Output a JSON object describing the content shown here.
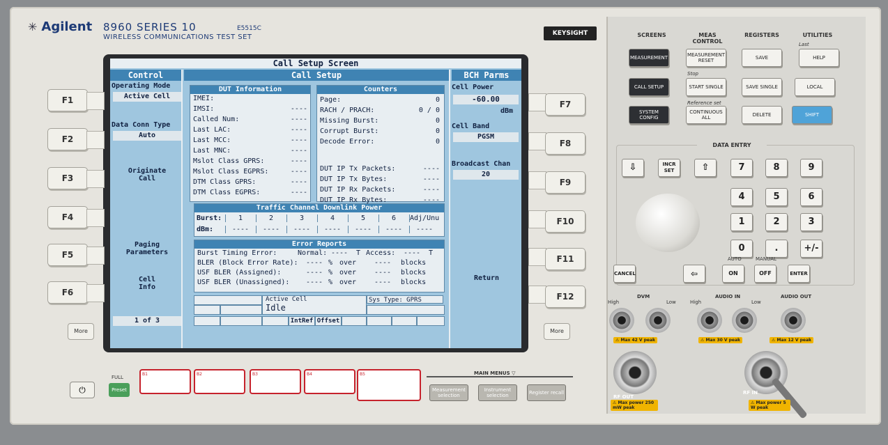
{
  "brand": {
    "logo": "Agilent",
    "series": "8960 SERIES 10",
    "subtitle": "WIRELESS COMMUNICATIONS TEST SET",
    "partno": "E5515C",
    "keysight": "KEYSIGHT"
  },
  "screen": {
    "title": "Call Setup Screen",
    "control_header": "Control",
    "call_setup_header": "Call Setup",
    "bch_header": "BCH Parms",
    "left_soft": {
      "operating_mode_label": "Operating Mode",
      "operating_mode_value": "Active Cell",
      "data_conn_label": "Data Conn Type",
      "data_conn_value": "Auto",
      "originate": "Originate\nCall",
      "paging": "Paging\nParameters",
      "cell_info": "Cell\nInfo",
      "page_indicator": "1 of 3"
    },
    "dut": {
      "header": "DUT Information",
      "rows": [
        {
          "label": "IMEI:",
          "value": ""
        },
        {
          "label": "IMSI:",
          "value": "----"
        },
        {
          "label": "Called Num:",
          "value": "----"
        },
        {
          "label": "Last LAC:",
          "value": "----"
        },
        {
          "label": "Last MCC:",
          "value": "----"
        },
        {
          "label": "Last MNC:",
          "value": "----"
        },
        {
          "label": "Mslot Class GPRS:",
          "value": "----"
        },
        {
          "label": "Mslot Class EGPRS:",
          "value": "----"
        },
        {
          "label": "DTM Class GPRS:",
          "value": "----"
        },
        {
          "label": "DTM Class EGPRS:",
          "value": "----"
        }
      ]
    },
    "counters": {
      "header": "Counters",
      "rows": [
        {
          "label": "Page:",
          "value": "0"
        },
        {
          "label": "RACH / PRACH:",
          "value": "0 / 0"
        },
        {
          "label": "Missing Burst:",
          "value": "0"
        },
        {
          "label": "Corrupt Burst:",
          "value": "0"
        },
        {
          "label": "Decode Error:",
          "value": "0"
        },
        {
          "label": "DUT IP Tx Packets:",
          "value": "----"
        },
        {
          "label": "DUT IP Tx Bytes:",
          "value": "----"
        },
        {
          "label": "DUT IP Rx Packets:",
          "value": "----"
        },
        {
          "label": "DUT IP Rx Bytes:",
          "value": "----"
        }
      ]
    },
    "traffic": {
      "header": "Traffic Channel Downlink Power",
      "burst_label": "Burst:",
      "dbm_label": "dBm:",
      "columns": [
        "1",
        "2",
        "3",
        "4",
        "5",
        "6",
        "Adj/Unu"
      ],
      "dbm_values": [
        "----",
        "----",
        "----",
        "----",
        "----",
        "----",
        "----"
      ]
    },
    "errors": {
      "header": "Error Reports",
      "line1_label": "Burst Timing Error:",
      "line1_normal": "Normal:",
      "line1_nval": "----",
      "line1_t": "T",
      "line1_access": "Access:",
      "line1_aval": "----",
      "line1_t2": "T",
      "rows": [
        {
          "label": "BLER (Block Error Rate):",
          "val": "----",
          "pct": "%",
          "over": "over",
          "blocks_val": "----",
          "blocks": "blocks"
        },
        {
          "label": "USF BLER (Assigned):",
          "val": "----",
          "pct": "%",
          "over": "over",
          "blocks_val": "----",
          "blocks": "blocks"
        },
        {
          "label": "USF BLER (Unassigned):",
          "val": "----",
          "pct": "%",
          "over": "over",
          "blocks_val": "----",
          "blocks": "blocks"
        }
      ]
    },
    "status": {
      "active_cell": "Active Cell",
      "idle": "Idle",
      "sys_type": "Sys Type: GPRS",
      "intref": "IntRef",
      "offset": "Offset"
    },
    "bch": {
      "cell_power_label": "Cell Power",
      "cell_power_value": "-60.00",
      "cell_power_unit": "dBm",
      "cell_band_label": "Cell Band",
      "cell_band_value": "PGSM",
      "broadcast_label": "Broadcast Chan",
      "broadcast_value": "20",
      "return": "Return"
    }
  },
  "fkeys_left": [
    "F1",
    "F2",
    "F3",
    "F4",
    "F5",
    "F6"
  ],
  "fkeys_right": [
    "F7",
    "F8",
    "F9",
    "F10",
    "F11",
    "F12"
  ],
  "more_label": "More",
  "bottom": {
    "full": "FULL",
    "preset": "Preset",
    "main_menus": "MAIN MENUS",
    "mm1": "Measurement selection",
    "mm2": "Instrument selection",
    "mm3": "Register recall"
  },
  "stickers": [
    "B1",
    "B2",
    "B3",
    "B4",
    "B5"
  ],
  "panel": {
    "screens": "SCREENS",
    "meas_control": "MEAS CONTROL",
    "registers": "REGISTERS",
    "utilities": "UTILITIES",
    "measurement": "MEASUREMENT",
    "call_setup": "CALL SETUP",
    "system_config": "SYSTEM CONFIG",
    "meas_reset": "MEASUREMENT RESET",
    "stop": "Stop",
    "start_single": "START SINGLE",
    "reference_set": "Reference set",
    "continuous_all": "CONTINUOUS ALL",
    "save": "SAVE",
    "save_single": "SAVE SINGLE",
    "delete": "DELETE",
    "last": "Last",
    "help": "HELP",
    "local": "LOCAL",
    "shift": "SHIFT",
    "data_entry": "DATA ENTRY",
    "incr_set": "INCR SET",
    "digits": [
      "7",
      "8",
      "9",
      "4",
      "5",
      "6",
      "1",
      "2",
      "3",
      "0",
      ".",
      "+/-"
    ],
    "cancel": "CANCEL",
    "auto": "AUTO",
    "manual": "MANUAL",
    "on": "ON",
    "off": "OFF",
    "enter": "ENTER",
    "dvm": "DVM",
    "audio_in": "AUDIO IN",
    "audio_out": "AUDIO OUT",
    "high": "High",
    "low": "Low",
    "max42": "Max 42 V peak",
    "max30": "Max 30 V peak",
    "max12": "Max 12 V peak",
    "rf_out": "RF OUT",
    "rf_in": "RF IN",
    "rf_out_max": "Max power 250 mW peak",
    "rf_in_max": "Max power 5 W peak"
  }
}
